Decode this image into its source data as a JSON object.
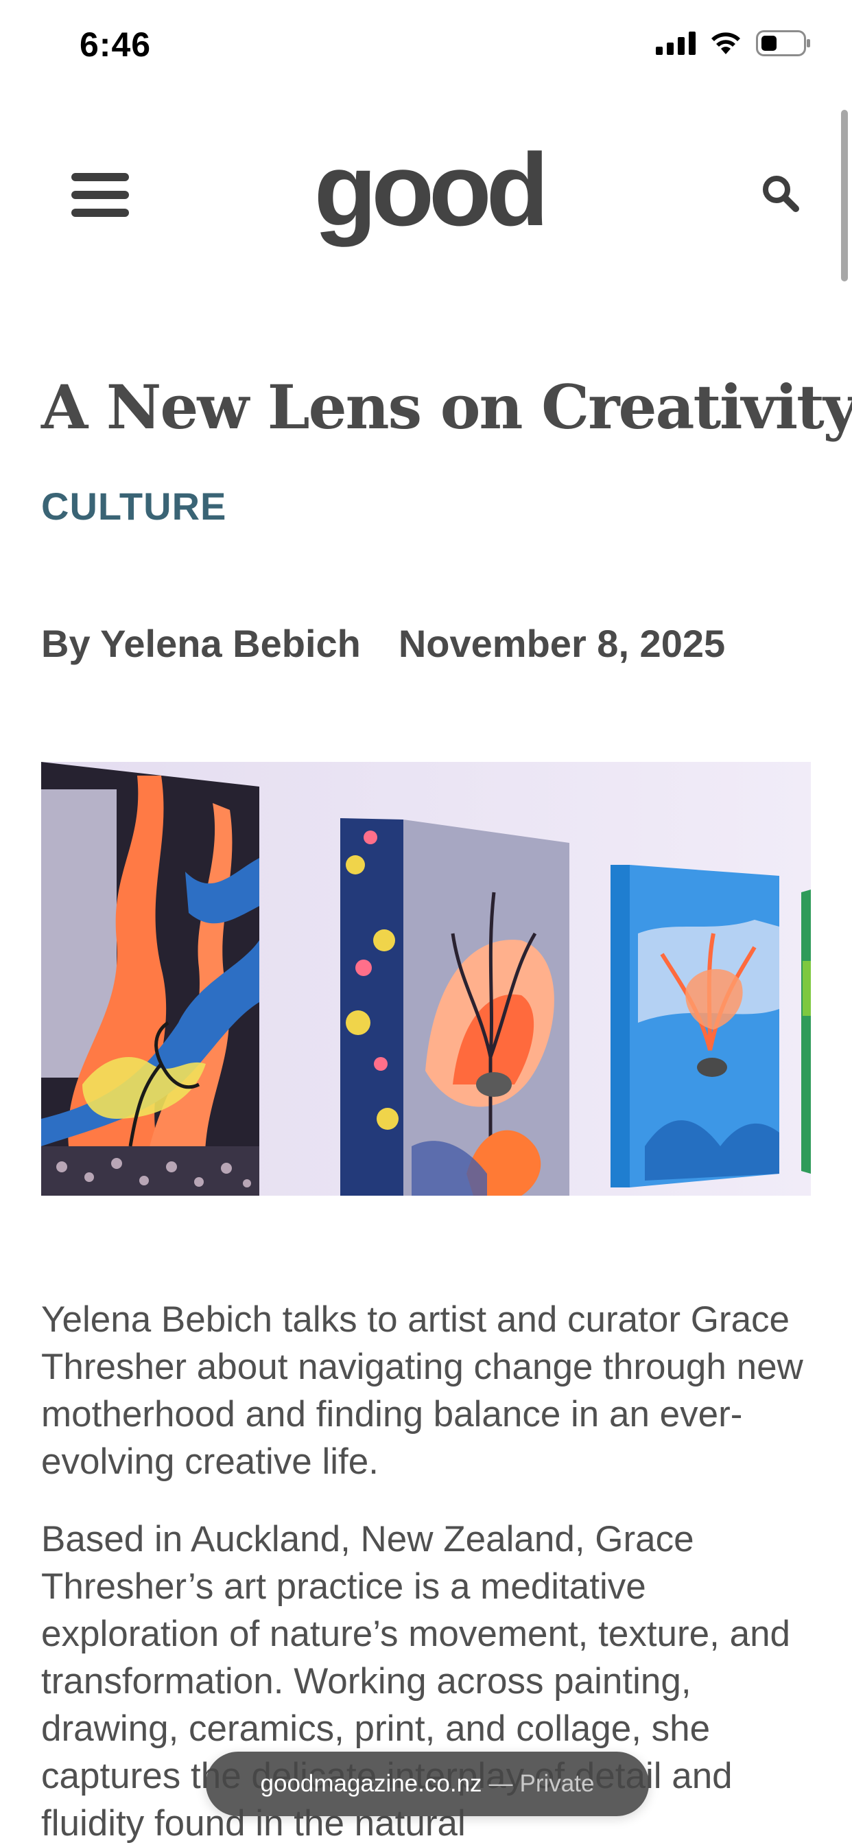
{
  "status_bar": {
    "time": "6:46",
    "icons": [
      "cellular-signal-icon",
      "wifi-icon",
      "battery-icon"
    ]
  },
  "header": {
    "logo_text": "good",
    "menu_icon": "hamburger-menu-icon",
    "search_icon": "search-icon"
  },
  "article": {
    "title": "A New Lens on Creativity",
    "category": "CULTURE",
    "author": "By Yelena Bebich",
    "date": "November 8, 2025",
    "hero_image": "Coral-themed paintings hanging on a gallery wall",
    "paragraphs": [
      "Yelena Bebich talks to artist and curator Grace Thresher about navigating change through new motherhood and finding balance in an ever-evolving creative life.",
      "Based in Auckland, New Zealand, Grace Thresher’s art practice is a meditative exploration of nature’s movement, texture, and transformation. Working across painting, drawing, ceramics, print, and collage, she captures the delicate interplay of detail and fluidity found in the natural"
    ]
  },
  "browser": {
    "url": "goodmagazine.co.nz",
    "separator": "—",
    "mode": "Private"
  },
  "colors": {
    "text": "#4a4a4a",
    "category": "#3a6475",
    "logo": "#444444"
  }
}
